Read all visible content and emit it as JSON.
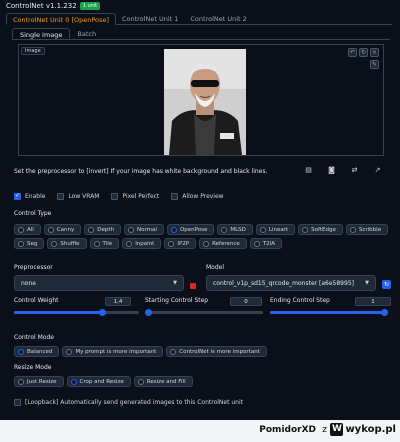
{
  "header": {
    "title": "ControlNet v1.1.232",
    "badge": "1 unit"
  },
  "unit_tabs": [
    "ControlNet Unit 0 [OpenPose]",
    "ControlNet Unit 1",
    "ControlNet Unit 2"
  ],
  "sub_tabs": [
    "Single Image",
    "Batch"
  ],
  "image_label": "Image",
  "hint": "Set the preprocessor to [invert] If your image has white background and black lines.",
  "checkboxes": [
    {
      "label": "Enable",
      "checked": true
    },
    {
      "label": "Low VRAM",
      "checked": false
    },
    {
      "label": "Pixel Perfect",
      "checked": false
    },
    {
      "label": "Allow Preview",
      "checked": false
    }
  ],
  "control_type": {
    "label": "Control Type",
    "selected": "OpenPose",
    "options": [
      "All",
      "Canny",
      "Depth",
      "Normal",
      "OpenPose",
      "MLSD",
      "Lineart",
      "SoftEdge",
      "Scribble",
      "Seg",
      "Shuffle",
      "Tile",
      "Inpaint",
      "IP2P",
      "Reference",
      "T2IA"
    ]
  },
  "preprocessor": {
    "label": "Preprocessor",
    "value": "none"
  },
  "model": {
    "label": "Model",
    "value": "control_v1p_sd15_qrcode_monster [a6e58995]"
  },
  "control_weight": {
    "label": "Control Weight",
    "value": "1,4",
    "fraction": 0.7
  },
  "start_step": {
    "label": "Starting Control Step",
    "value": "0",
    "fraction": 0
  },
  "end_step": {
    "label": "Ending Control Step",
    "value": "1",
    "fraction": 1
  },
  "control_mode": {
    "label": "Control Mode",
    "selected": "Balanced",
    "options": [
      "Balanced",
      "My prompt is more important",
      "ControlNet is more important"
    ]
  },
  "resize_mode": {
    "label": "Resize Mode",
    "selected": "Crop and Resize",
    "options": [
      "Just Resize",
      "Crop and Resize",
      "Resize and Fill"
    ]
  },
  "loopback": "[Loopback] Automatically send generated images to this ControlNet unit",
  "watermark": {
    "user": "PomidorXD",
    "z": "z",
    "site": "wykop.pl"
  }
}
